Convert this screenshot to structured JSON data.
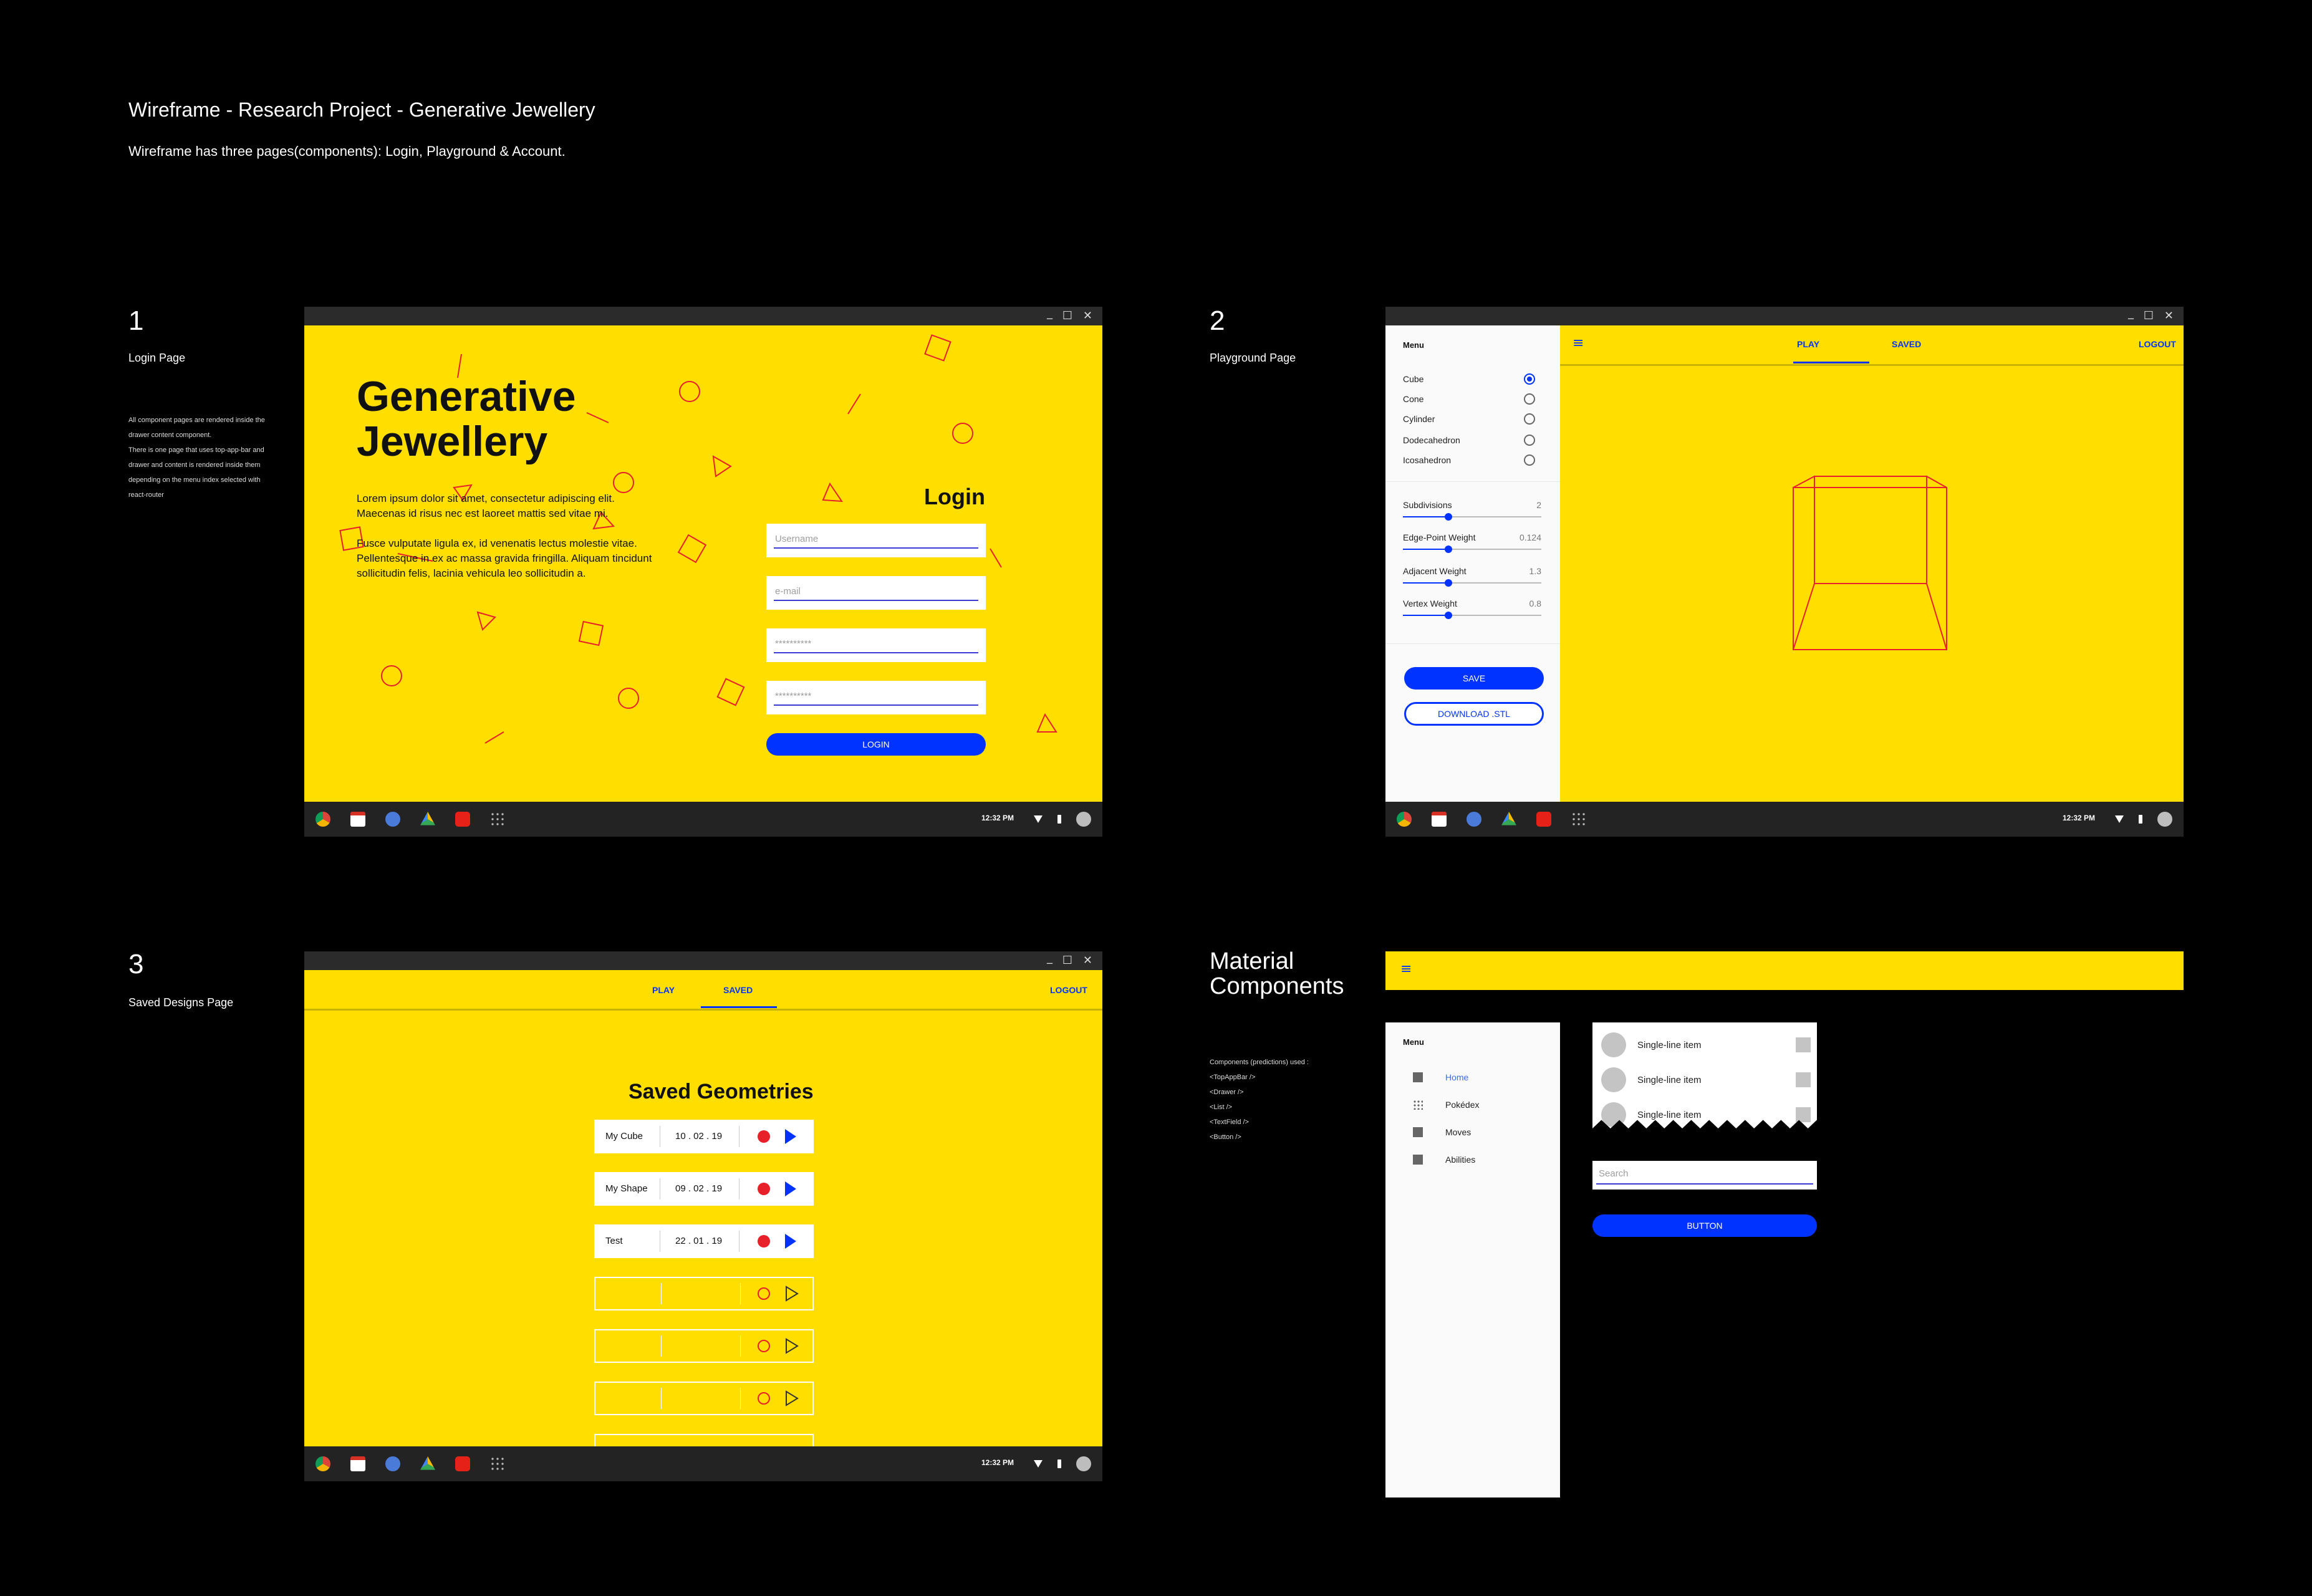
{
  "header": {
    "title": "Wireframe - Research Project - Generative Jewellery",
    "subtitle": "Wireframe has three pages(components): Login, Playground & Account."
  },
  "sections": {
    "login": {
      "number": "1",
      "label": "Login Page"
    },
    "playground": {
      "number": "2",
      "label": "Playground Page"
    },
    "saved": {
      "number": "3",
      "label": "Saved Designs Page"
    },
    "material": {
      "label_line1": "Material",
      "label_line2": "Components"
    }
  },
  "notes": {
    "line1": "All component pages are rendered inside the",
    "line2": "drawer content component.",
    "line3": "There is one page that uses top-app-bar and",
    "line4": "drawer and content is rendered inside them",
    "line5": "depending on the menu index selected with",
    "line6": "react-router"
  },
  "components_used": {
    "title": "Components (predictions) used :",
    "items": [
      "<TopAppBar />",
      "<Drawer />",
      "<List />",
      "<TextField />",
      "<Button />"
    ]
  },
  "window": {
    "minimize": "_",
    "maximize": "☐",
    "close": "✕"
  },
  "taskbar": {
    "time": "12:32 PM"
  },
  "login_page": {
    "title_line1": "Generative",
    "title_line2": "Jewellery",
    "para1_line1": "Lorem ipsum dolor sit amet, consectetur adipiscing elit.",
    "para1_line2": "Maecenas id risus nec est laoreet mattis sed vitae mi.",
    "para2_line1": "Fusce vulputate ligula ex, id venenatis lectus molestie vitae.",
    "para2_line2": "Pellentesque in ex ac massa gravida fringilla. Aliquam tincidunt",
    "para2_line3": "sollicitudin felis, lacinia vehicula leo sollicitudin a.",
    "form_title": "Login",
    "username_placeholder": "Username",
    "email_placeholder": "e-mail",
    "password_placeholder": "**********",
    "password_confirm_placeholder": "**********",
    "login_button": "LOGIN"
  },
  "playground_page": {
    "menu_title": "Menu",
    "shapes": [
      "Cube",
      "Cone",
      "Cylinder",
      "Dodecahedron",
      "Icosahedron"
    ],
    "selected_shape": "Cube",
    "sliders": [
      {
        "label": "Subdivisions",
        "value": "2",
        "level": 0.33
      },
      {
        "label": "Edge-Point Weight",
        "value": "0.124",
        "level": 0.33
      },
      {
        "label": "Adjacent Weight",
        "value": "1.3",
        "level": 0.33
      },
      {
        "label": "Vertex Weight",
        "value": "0.8",
        "level": 0.33
      }
    ],
    "save_button": "SAVE",
    "download_button": "DOWNLOAD .STL",
    "tab_play": "PLAY",
    "tab_saved": "SAVED",
    "logout": "LOGOUT",
    "menu_icon": "≡"
  },
  "saved_page": {
    "tab_play": "PLAY",
    "tab_saved": "SAVED",
    "logout": "LOGOUT",
    "title": "Saved Geometries",
    "rows": [
      {
        "name": "My Cube",
        "date": "10 . 02 . 19"
      },
      {
        "name": "My Shape",
        "date": "09 . 02 . 19"
      },
      {
        "name": "Test",
        "date": "22 . 01 . 19"
      }
    ]
  },
  "material": {
    "menu_icon": "≡",
    "drawer_title": "Menu",
    "drawer_items": [
      "Home",
      "Pokédex",
      "Moves",
      "Abilities"
    ],
    "list_items": [
      "Single-line item",
      "Single-line item",
      "Single-line item"
    ],
    "search_placeholder": "Search",
    "button": "BUTTON"
  },
  "colors": {
    "yellow": "#FFDE00",
    "blue": "#0033FF",
    "red": "#E8202A"
  }
}
